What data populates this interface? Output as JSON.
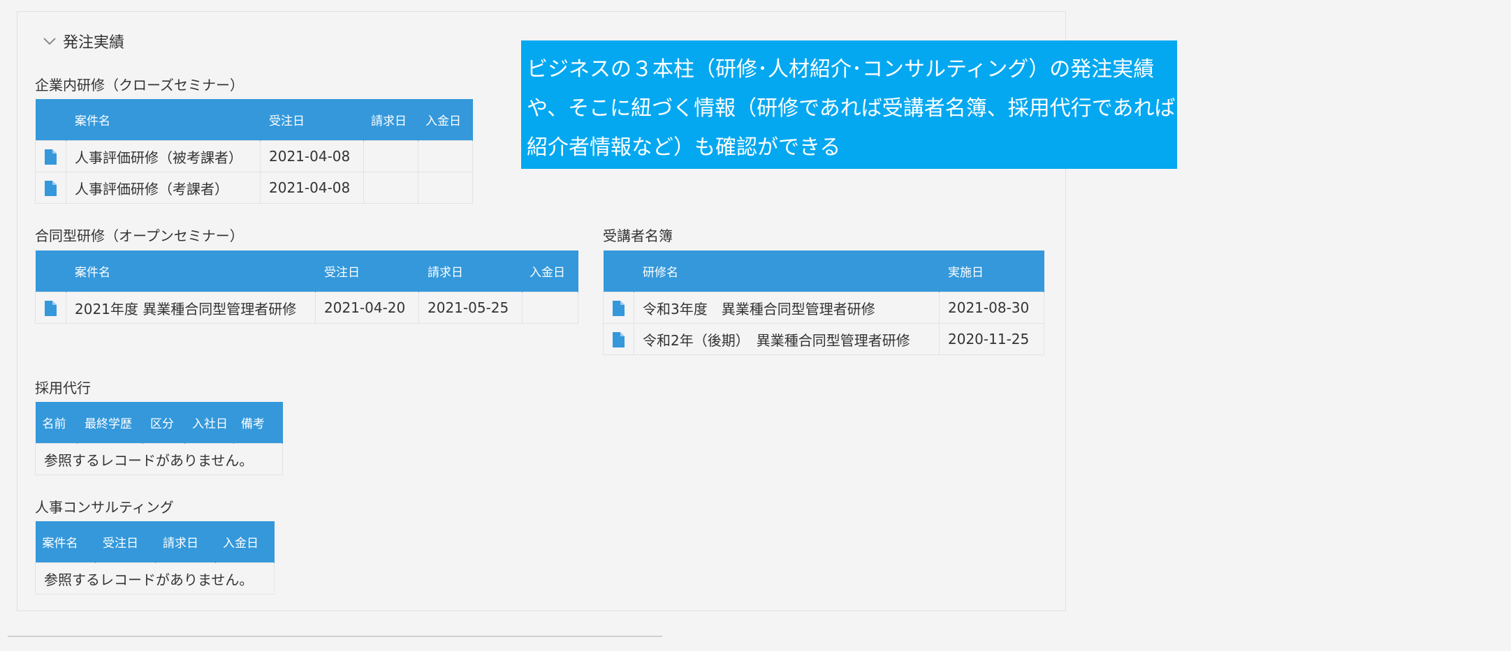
{
  "group": {
    "title": "発注実績",
    "icon": "chevron-down-icon"
  },
  "callout": {
    "text": "ビジネスの３本柱（研修･人材紹介･コンサルティング）の発注実績や、そこに紐づく情報（研修であれば受講者名簿、採用代行であれば紹介者情報など）も確認ができる",
    "color": "#04a8f0"
  },
  "tables": {
    "closed_seminar": {
      "label": "企業内研修（クローズセミナー）",
      "columns": [
        "案件名",
        "受注日",
        "請求日",
        "入金日"
      ],
      "rows": [
        {
          "name": "人事評価研修（被考課者）",
          "ordered": "2021-04-08",
          "billed": "",
          "paid": ""
        },
        {
          "name": "人事評価研修（考課者）",
          "ordered": "2021-04-08",
          "billed": "",
          "paid": ""
        }
      ]
    },
    "open_seminar": {
      "label": "合同型研修（オープンセミナー）",
      "columns": [
        "案件名",
        "受注日",
        "請求日",
        "入金日"
      ],
      "rows": [
        {
          "name": "2021年度 異業種合同型管理者研修",
          "ordered": "2021-04-20",
          "billed": "2021-05-25",
          "paid": ""
        }
      ]
    },
    "attendees": {
      "label": "受講者名簿",
      "columns": [
        "研修名",
        "実施日"
      ],
      "rows": [
        {
          "name": "令和3年度　異業種合同型管理者研修",
          "date": "2021-08-30"
        },
        {
          "name": "令和2年（後期）　異業種合同型管理者研修",
          "date": "2020-11-25"
        }
      ]
    },
    "recruiting": {
      "label": "採用代行",
      "columns": [
        "名前",
        "最終学歴",
        "区分",
        "入社日",
        "備考"
      ],
      "empty": "参照するレコードがありません。"
    },
    "consulting": {
      "label": "人事コンサルティング",
      "columns": [
        "案件名",
        "受注日",
        "請求日",
        "入金日"
      ],
      "empty": "参照するレコードがありません。"
    }
  },
  "colors": {
    "header": "#3498db",
    "background": "#f4f4f4"
  }
}
